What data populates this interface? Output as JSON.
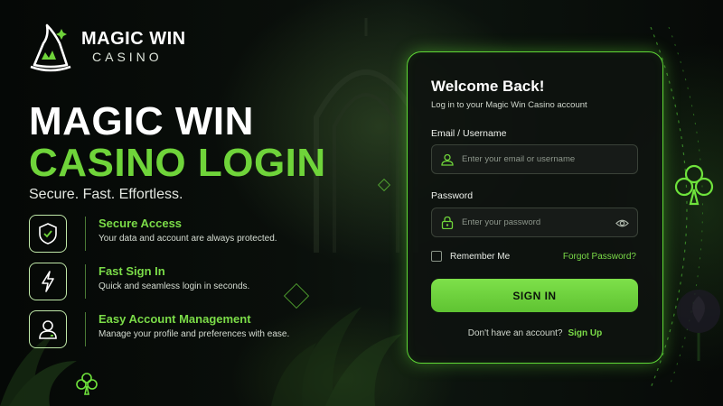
{
  "brand": {
    "name": "MAGIC WIN",
    "sub": "CASINO"
  },
  "hero": {
    "line1": "MAGIC WIN",
    "line2": "CASINO LOGIN",
    "tagline": "Secure. Fast. Effortless."
  },
  "features": [
    {
      "icon": "shield-check-icon",
      "title": "Secure Access",
      "desc": "Your data and account are always protected."
    },
    {
      "icon": "lightning-icon",
      "title": "Fast Sign In",
      "desc": "Quick and seamless login in seconds."
    },
    {
      "icon": "user-icon",
      "title": "Easy Account Management",
      "desc": "Manage your profile and preferences with ease."
    }
  ],
  "login": {
    "title": "Welcome Back!",
    "subtitle": "Log in to your Magic Win Casino account",
    "email_label": "Email / Username",
    "email_placeholder": "Enter your email or username",
    "email_value": "",
    "password_label": "Password",
    "password_placeholder": "Enter your password",
    "password_value": "",
    "remember_label": "Remember Me",
    "remember_checked": false,
    "forgot_label": "Forgot Password?",
    "signin_label": "SIGN IN",
    "signup_prompt": "Don't have an account?",
    "signup_link": "Sign Up"
  },
  "colors": {
    "accent": "#6fd43a",
    "background": "#0a0f0b",
    "card_border": "#5fd836"
  }
}
